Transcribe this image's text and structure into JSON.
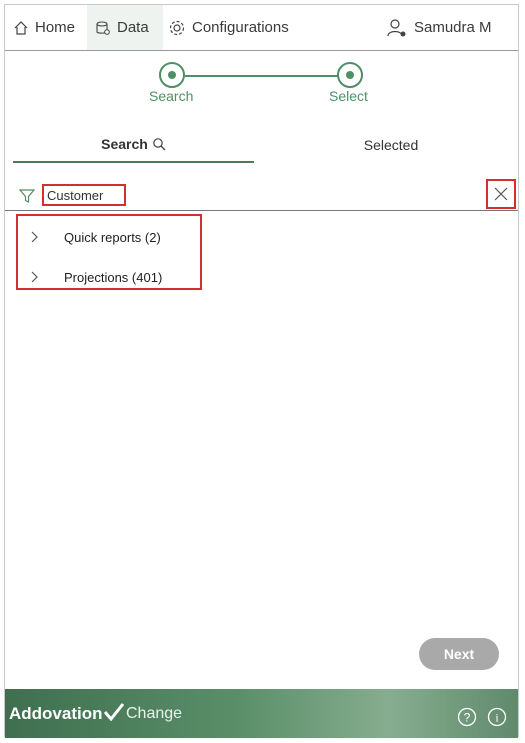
{
  "nav": {
    "home": "Home",
    "data": "Data",
    "configurations": "Configurations",
    "user": "Samudra M"
  },
  "stepper": {
    "steps": [
      "Search",
      "Select"
    ]
  },
  "tabs": {
    "search": "Search",
    "selected": "Selected"
  },
  "filter": {
    "value": "Customer"
  },
  "results": [
    {
      "label": "Quick reports (2)"
    },
    {
      "label": "Projections (401)"
    }
  ],
  "next_label": "Next",
  "footer": {
    "brand": "Addovation",
    "suffix": "Change"
  },
  "colors": {
    "accent": "#4f8f65",
    "highlight": "#d32f2f",
    "button_disabled": "#a9a9a9"
  }
}
